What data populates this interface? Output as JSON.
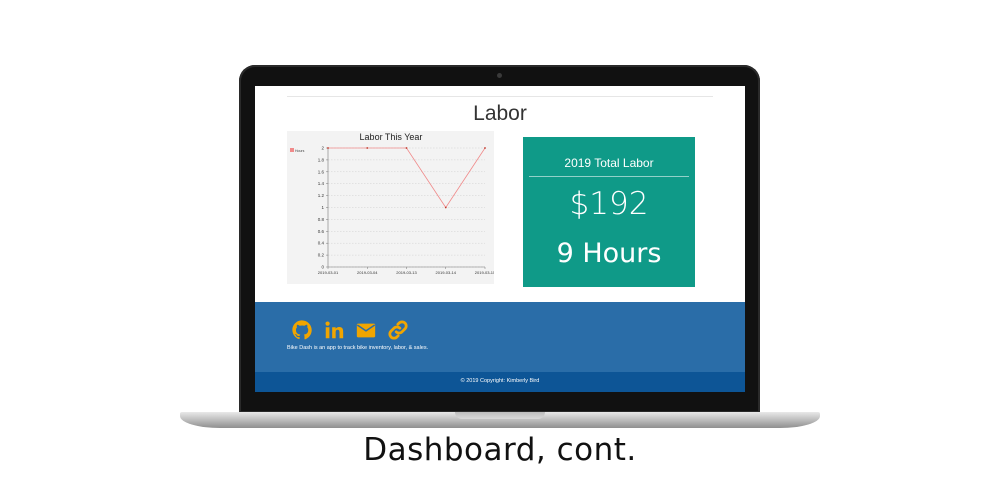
{
  "page": {
    "title": "Labor",
    "caption": "Dashboard, cont."
  },
  "chart_data": {
    "type": "line",
    "title": "Labor This Year",
    "categories": [
      "2019-03-01",
      "2019-03-04",
      "2019-03-13",
      "2019-03-14",
      "2019-03-15"
    ],
    "tick_labels": [
      "2019-03-01",
      "2019-03-04",
      "2019-03-13",
      "2019-03-14",
      "2019-03-15"
    ],
    "series": [
      {
        "name": "Hours",
        "values": [
          2,
          2,
          2,
          1,
          2
        ],
        "color": "#f08a8a"
      }
    ],
    "y_ticks": [
      "0",
      "0.2",
      "0.4",
      "0.6",
      "0.8",
      "1",
      "1.2",
      "1.4",
      "1.6",
      "1.8",
      "2"
    ],
    "ylim": [
      0,
      2
    ],
    "grid": true,
    "legend_position": "left"
  },
  "summary_card": {
    "title": "2019 Total Labor",
    "amount": "$192",
    "hours": "9 Hours",
    "background_color": "#0f9a88"
  },
  "footer": {
    "icons": [
      "github-icon",
      "linkedin-icon",
      "envelope-icon",
      "link-icon"
    ],
    "icon_color": "#f0a500",
    "description": "Bike Dash is an app to track bike inventory, labor, & sales.",
    "copyright": "© 2019 Copyright: Kimberly Bird",
    "background_color": "#2a6da8",
    "copyright_background_color": "#0d5596"
  }
}
